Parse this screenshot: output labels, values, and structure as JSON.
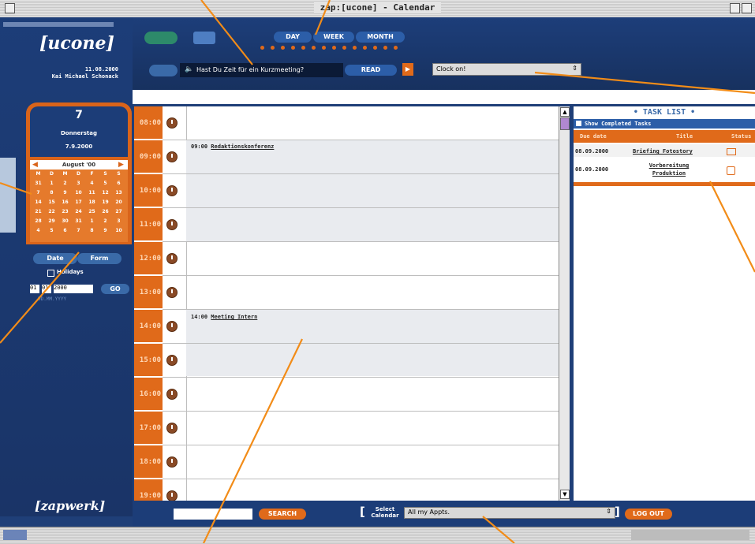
{
  "window": {
    "title": "zap:[ucone] - Calendar"
  },
  "sidebar": {
    "logo": "[ucone]",
    "date": "11.08.2000",
    "user": "Kai Michael Schonack",
    "day_number": "7",
    "weekday": "Donnerstag",
    "full_date": "7.9.2000",
    "mini_calendar": {
      "month": "August '00",
      "weekdays": [
        "M",
        "D",
        "M",
        "D",
        "F",
        "S",
        "S"
      ],
      "weeks": [
        [
          "31",
          "1",
          "2",
          "3",
          "4",
          "5",
          "6"
        ],
        [
          "7",
          "8",
          "9",
          "10",
          "11",
          "12",
          "13"
        ],
        [
          "14",
          "15",
          "16",
          "17",
          "18",
          "19",
          "20"
        ],
        [
          "21",
          "22",
          "23",
          "24",
          "25",
          "26",
          "27"
        ],
        [
          "28",
          "29",
          "30",
          "31",
          "1",
          "2",
          "3"
        ],
        [
          "4",
          "5",
          "6",
          "7",
          "8",
          "9",
          "10"
        ]
      ]
    },
    "tabs": [
      "Date",
      "Form"
    ],
    "holidays_label": "Holidays",
    "date_inputs": [
      "01",
      "01",
      "2000"
    ],
    "go_label": "GO",
    "date_format": "DD.MM.YYYY",
    "footer_logo": "[zapwerk]"
  },
  "toolbar": {
    "view_tabs": [
      "DAY",
      "WEEK",
      "MONTH"
    ],
    "message": "Hast Du Zeit für ein Kurzmeeting?",
    "read_label": "READ",
    "select_value": "Clock on!"
  },
  "schedule": {
    "times": [
      "08:00",
      "09:00",
      "10:00",
      "11:00",
      "12:00",
      "13:00",
      "14:00",
      "15:00",
      "16:00",
      "17:00",
      "18:00",
      "19:00"
    ],
    "appointments": [
      {
        "time": "09:00",
        "title": "Redaktionskonferenz"
      },
      {
        "time": "14:00",
        "title": "Meeting Intern"
      }
    ]
  },
  "tasks": {
    "title": "• TASK LIST •",
    "show_completed": "Show Completed Tasks",
    "headers": [
      "Due date",
      "Title",
      "Status"
    ],
    "rows": [
      {
        "due": "08.09.2000",
        "title": "Briefing Fotostory"
      },
      {
        "due": "08.09.2000",
        "title": "Vorbereitung Produktion"
      }
    ]
  },
  "bottom": {
    "search_label": "SEARCH",
    "select_calendar_label": "Select Calendar",
    "calendar_value": "All my Appts.",
    "logout_label": "LOG OUT"
  },
  "colors": {
    "brand_blue": "#1f3f78",
    "accent_orange": "#e06a1a",
    "callout": "#f28c18"
  }
}
